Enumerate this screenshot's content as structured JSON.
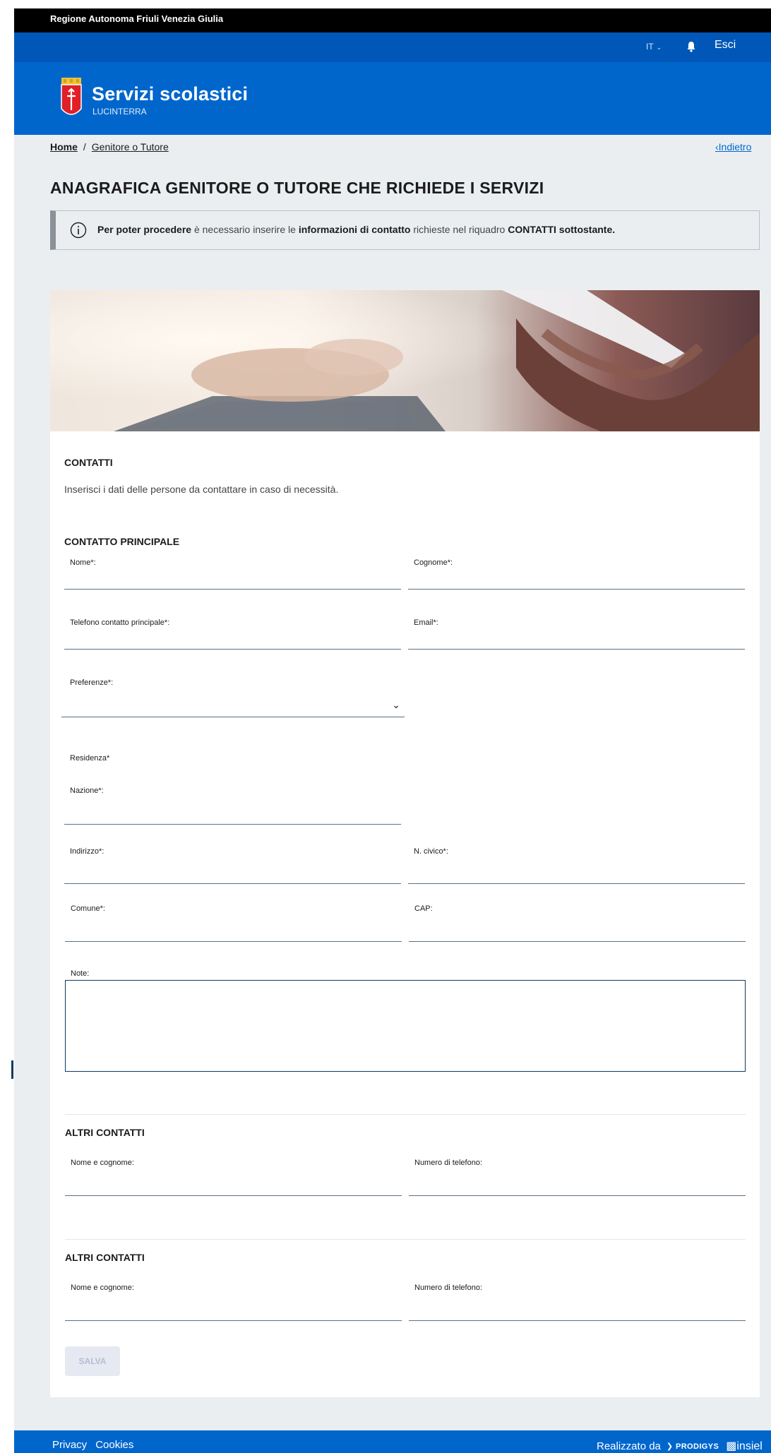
{
  "header": {
    "region": "Regione Autonoma Friuli Venezia Giulia",
    "lang": "IT",
    "logout": "Esci",
    "app_title": "Servizi scolastici",
    "app_subtitle": "LUCINTERRA"
  },
  "breadcrumb": {
    "home": "Home",
    "separator": "/",
    "current": "Genitore o Tutore",
    "back": "Indietro"
  },
  "page_title": "ANAGRAFICA GENITORE O TUTORE CHE RICHIEDE I SERVIZI",
  "alert": {
    "p1": "Per poter procedere",
    "p2": " è necessario inserire le ",
    "p3": "informazioni di contatto",
    "p4": " richieste nel riquadro ",
    "p5": "CONTATTI sottostante."
  },
  "contacts": {
    "title": "CONTATTI",
    "description": "Inserisci i dati delle persone da contattare in caso di necessità.",
    "main_title": "CONTATTO PRINCIPALE",
    "nome": "Nome*:",
    "cognome": "Cognome*:",
    "telefono": "Telefono contatto principale*:",
    "email": "Email*:",
    "preferenze": "Preferenze*:",
    "residenza": "Residenza*",
    "nazione": "Nazione*:",
    "indirizzo": "Indirizzo*:",
    "civico": "N. civico*:",
    "comune": "Comune*:",
    "cap": "CAP:",
    "note": "Note:"
  },
  "other_contacts": [
    {
      "title": "ALTRI CONTATTI",
      "name_label": "Nome e cognome:",
      "phone_label": "Numero di telefono:"
    },
    {
      "title": "ALTRI CONTATTI",
      "name_label": "Nome e cognome:",
      "phone_label": "Numero di telefono:"
    }
  ],
  "save_label": "SALVA",
  "footer": {
    "privacy": "Privacy",
    "cookies": "Cookies",
    "made_by": "Realizzato da",
    "prodigys": "PRODIGYS",
    "insiel": "insiel"
  },
  "colors": {
    "primary": "#0066cc",
    "utility_bar": "#0057b8",
    "top_bar": "#000000",
    "page_bg": "#ebeef1"
  }
}
